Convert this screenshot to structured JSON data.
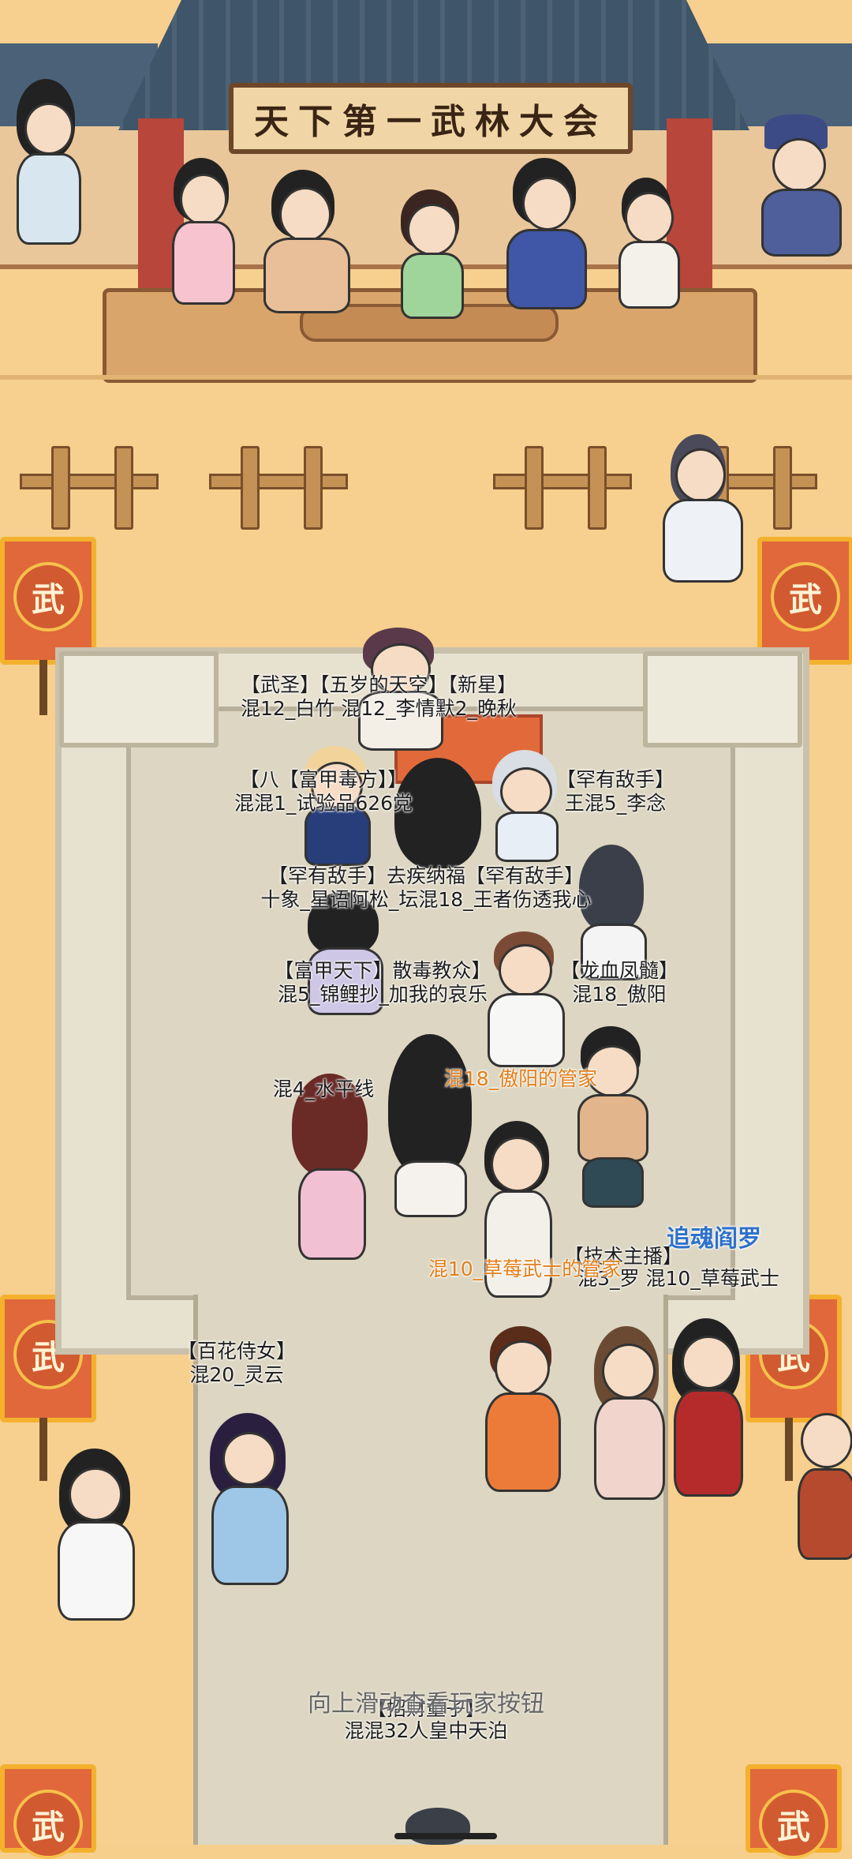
{
  "scene": {
    "sign_text": "天下第一武林大会",
    "banner_glyph": "武"
  },
  "labels": {
    "group_a": {
      "title": "【武圣】【五岁的天空】【新星】",
      "names": "混12_白竹 混12_李情默2_晚秋"
    },
    "group_b": {
      "title": "【八【富甲毒方】】",
      "names": "混混1_试验品626党"
    },
    "group_c": {
      "title": "【罕有敌手】",
      "names": "王混5_李念"
    },
    "group_d": {
      "title": "【罕有敌手】去疾纳福【罕有敌手】",
      "names": "十象_星语阿松_坛混18_王者伤透我心"
    },
    "group_e": {
      "title": "【富甲天下】散毒教众】",
      "names": "混5_锦鲤抄_加我的哀乐"
    },
    "group_f": {
      "title": "【龙血凤髓】",
      "names": "混18_傲阳"
    },
    "single_1": "混4_水平线",
    "orange_1": "混18_傲阳的管家",
    "group_g": {
      "title": "【技术主播】",
      "names": "混3_罗 混10_草莓武士"
    },
    "orange_2": "混10_草莓武士的管家",
    "blue_tag": "追魂阎罗",
    "group_h": {
      "title": "【百花侍女】",
      "names": "混20_灵云"
    },
    "group_i": {
      "title": "【招财童子】",
      "names": "混混32人皇中天泊"
    }
  },
  "hint": "向上滑动查看玩家按钮",
  "colors": {
    "ground": "#f7d08f",
    "roof": "#3f5569",
    "banner": "#e0683b",
    "banner_border": "#f3b12d",
    "label_orange": "#e37f1a",
    "label_blue": "#2f71c9"
  }
}
